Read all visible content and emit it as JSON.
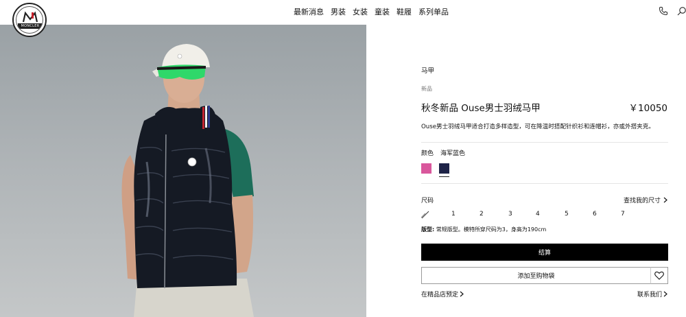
{
  "brand": {
    "logo_text": "MONCLER"
  },
  "nav": {
    "items": [
      "最新消息",
      "男装",
      "女装",
      "童装",
      "鞋履",
      "系列单品"
    ]
  },
  "header_icons": [
    "phone-icon",
    "search-icon"
  ],
  "product": {
    "breadcrumb": "马甲",
    "tag": "新品",
    "title": "秋冬新品 Ouse男士羽绒马甲",
    "price": "￥10050",
    "description": "Ouse男士羽绒马甲适合打造多样造型，可在降温时搭配针织衫和连帽衫，亦或外搭夹克。",
    "color_label": "颜色",
    "selected_color": "海军蓝色",
    "colors": [
      {
        "name": "pink",
        "hex": "#d9579c",
        "selected": false
      },
      {
        "name": "navy",
        "hex": "#1e2347",
        "selected": true
      }
    ],
    "size_label": "尺码",
    "size_guide": "查找我的尺寸",
    "sizes": [
      "1",
      "2",
      "3",
      "4",
      "5",
      "6",
      "7"
    ],
    "fit_label": "版型:",
    "fit_text": "常规版型。模特所穿尺码为3，身高为190cm",
    "checkout_label": "结算",
    "add_to_cart_label": "添加至购物袋",
    "store_reserve_label": "在精品店预定",
    "contact_label": "联系我们"
  }
}
